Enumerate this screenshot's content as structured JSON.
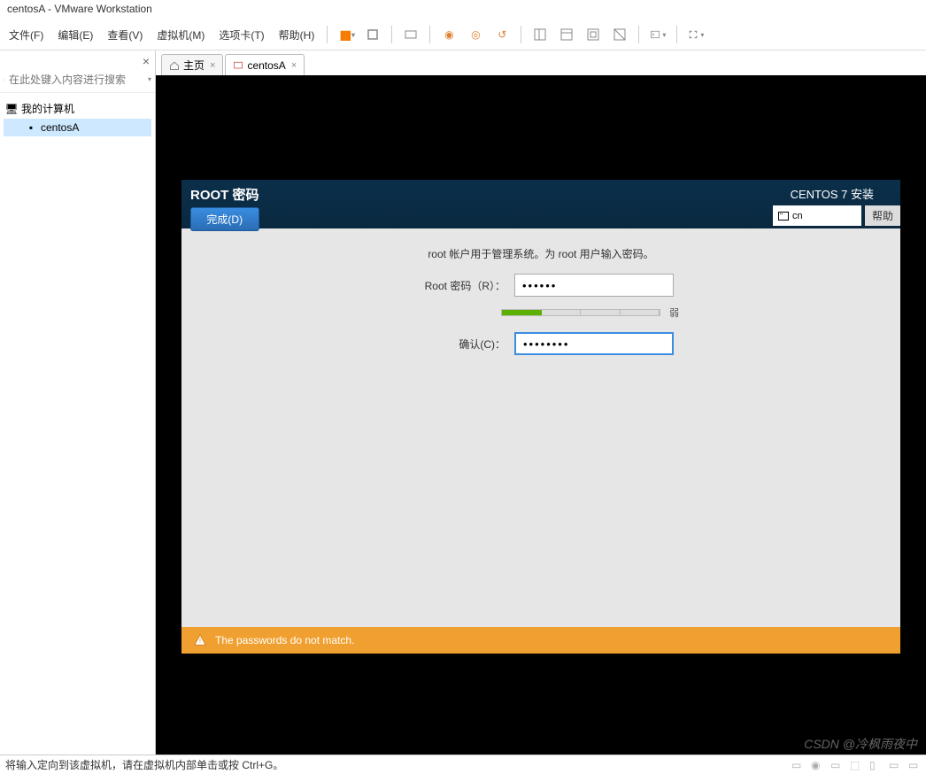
{
  "window": {
    "title": "centosA - VMware Workstation"
  },
  "menu": {
    "file": "文件(F)",
    "edit": "编辑(E)",
    "view": "查看(V)",
    "vm": "虚拟机(M)",
    "tabs": "选项卡(T)",
    "help": "帮助(H)"
  },
  "sidebar": {
    "search_placeholder": "在此处键入内容进行搜索",
    "root": "我的计算机",
    "child": "centosA"
  },
  "tabs": {
    "home": "主页",
    "active": "centosA"
  },
  "installer": {
    "title": "ROOT 密码",
    "done": "完成(D)",
    "product": "CENTOS 7 安装",
    "lang": "cn",
    "help": "帮助",
    "description": "root 帐户用于管理系统。为 root 用户输入密码。",
    "pw_label": "Root 密码（R）：",
    "pw_value": "••••••",
    "confirm_label": "确认(C)：",
    "confirm_value": "••••••••",
    "strength": "弱",
    "warning": "The passwords do not match."
  },
  "status": {
    "text": "将输入定向到该虚拟机，请在虚拟机内部单击或按 Ctrl+G。"
  },
  "watermark": "CSDN @冷枫雨夜中"
}
